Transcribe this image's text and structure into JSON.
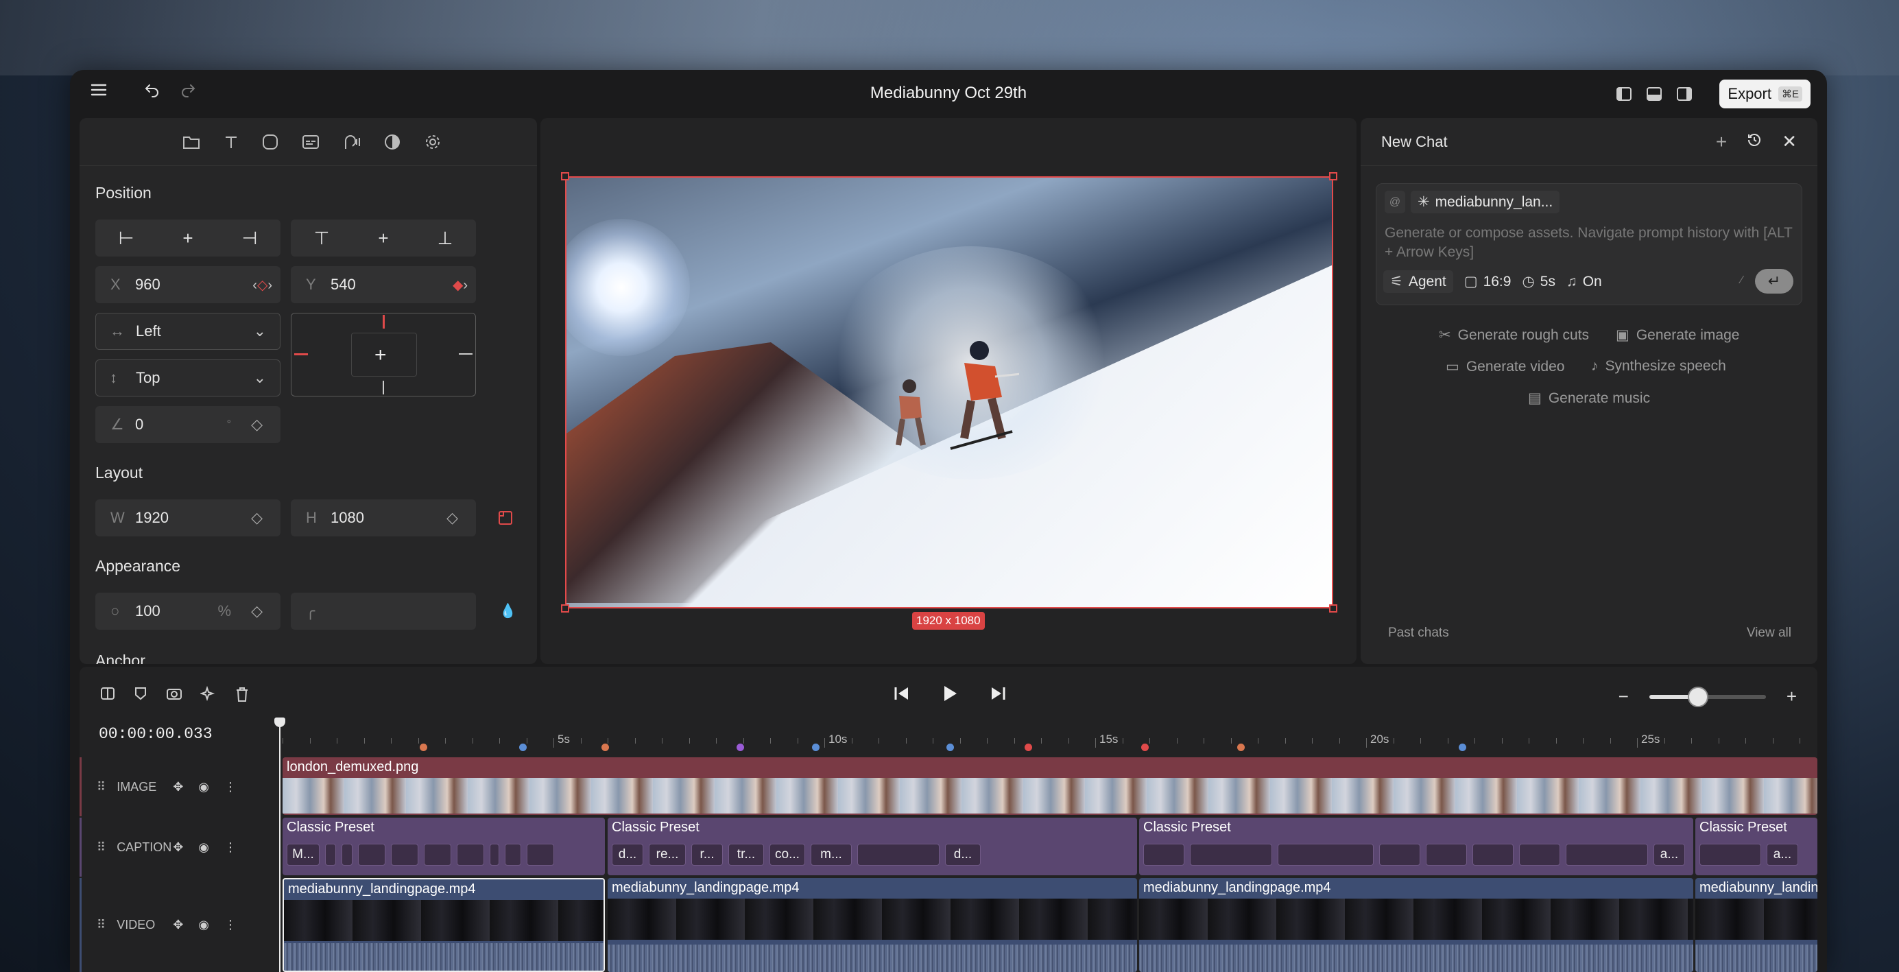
{
  "window": {
    "title": "Mediabunny Oct 29th",
    "export_label": "Export",
    "export_shortcut": "⌘E"
  },
  "inspector": {
    "position_title": "Position",
    "x_label": "X",
    "x_value": "960",
    "y_label": "Y",
    "y_value": "540",
    "h_align": "Left",
    "v_align": "Top",
    "rotation": "0",
    "rotation_unit": "°",
    "layout_title": "Layout",
    "w_label": "W",
    "w_value": "1920",
    "h_label": "H",
    "h_value": "1080",
    "appearance_title": "Appearance",
    "opacity": "100",
    "opacity_unit": "%",
    "anchor_title": "Anchor"
  },
  "canvas": {
    "dimensions": "1920 x 1080"
  },
  "chat": {
    "title": "New Chat",
    "at_symbol": "@",
    "context_chip": "mediabunny_lan...",
    "placeholder": "Generate or compose assets. Navigate prompt history with [ALT + Arrow Keys]",
    "mode": "Agent",
    "aspect": "16:9",
    "duration": "5s",
    "audio": "On",
    "suggestions": {
      "rough_cuts": "Generate rough cuts",
      "image": "Generate image",
      "video": "Generate video",
      "speech": "Synthesize speech",
      "music": "Generate music"
    },
    "past_chats": "Past chats",
    "view_all": "View all"
  },
  "timeline": {
    "timecode": "00:00:00.033",
    "ruler_labels": [
      "5s",
      "10s",
      "15s",
      "20s",
      "25s"
    ],
    "marker_colors": [
      "#d9774f",
      "#5b8ed6",
      "#d9774f",
      "#9a5bd6",
      "#5b8ed6",
      "#5b8ed6",
      "#e04a4a",
      "#e04a4a",
      "#d9774f",
      "#5b8ed6"
    ],
    "tracks": {
      "image": {
        "name": "IMAGE",
        "color": "#7a3a45",
        "clip": "london_demuxed.png"
      },
      "caption": {
        "name": "CAPTION",
        "color": "#5a4670",
        "clips": [
          {
            "name": "Classic Preset",
            "chips": [
              "M...",
              "",
              "",
              "",
              "",
              "",
              "",
              "",
              "",
              ""
            ]
          },
          {
            "name": "Classic Preset",
            "chips": [
              "d...",
              "re...",
              "r...",
              "tr...",
              "co...",
              "m...",
              "",
              "d..."
            ]
          },
          {
            "name": "Classic Preset",
            "chips": [
              "",
              "",
              "",
              "",
              "",
              "",
              "",
              "",
              "a..."
            ]
          },
          {
            "name": "Classic Preset",
            "chips": [
              "",
              "a..."
            ]
          }
        ]
      },
      "video": {
        "name": "VIDEO",
        "color": "#3d4d72",
        "clips": [
          "mediabunny_landingpage.mp4",
          "mediabunny_landingpage.mp4",
          "mediabunny_landingpage.mp4",
          "mediabunny_landin"
        ]
      }
    }
  }
}
